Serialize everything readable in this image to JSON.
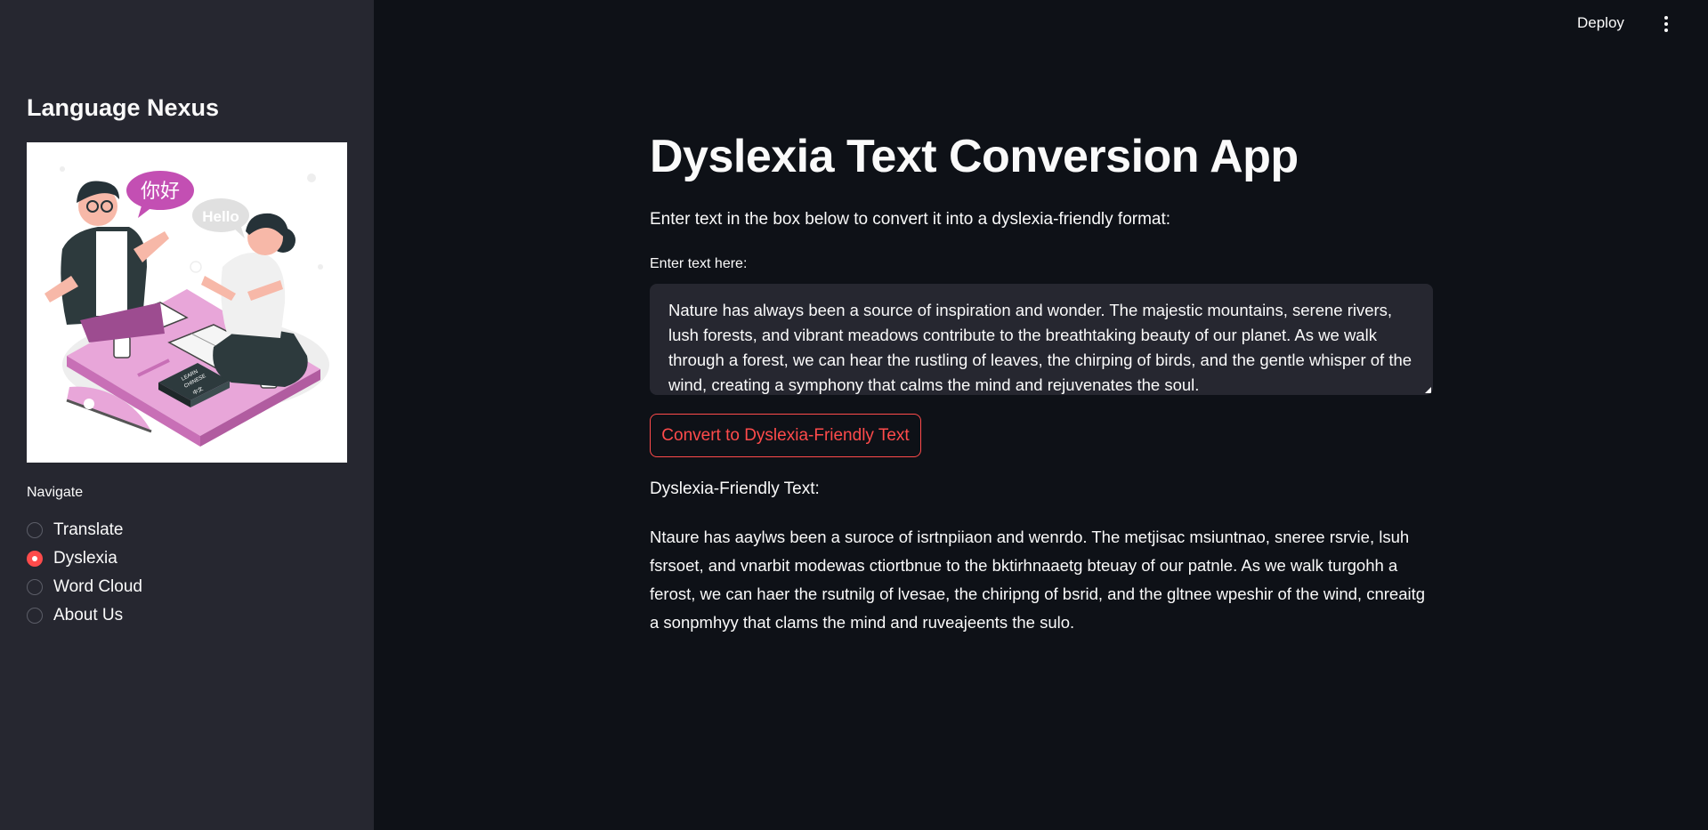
{
  "header": {
    "deploy_label": "Deploy",
    "menu_icon": "kebab-menu-icon"
  },
  "sidebar": {
    "title": "Language Nexus",
    "illustration": {
      "speech_bubble_chinese": "你好",
      "speech_bubble_english": "Hello",
      "book_text_1": "LEARN",
      "book_text_2": "CHINESE",
      "book_text_3": "中文"
    },
    "nav_label": "Navigate",
    "nav_items": [
      {
        "label": "Translate",
        "selected": false
      },
      {
        "label": "Dyslexia",
        "selected": true
      },
      {
        "label": "Word Cloud",
        "selected": false
      },
      {
        "label": "About Us",
        "selected": false
      }
    ]
  },
  "main": {
    "title": "Dyslexia Text Conversion App",
    "instructions": "Enter text in the box below to convert it into a dyslexia-friendly format:",
    "input_label": "Enter text here:",
    "input_value": "Nature has always been a source of inspiration and wonder. The majestic mountains, serene rivers, lush forests, and vibrant meadows contribute to the breathtaking beauty of our planet. As we walk through a forest, we can hear the rustling of leaves, the chirping of birds, and the gentle whisper of the wind, creating a symphony that calms the mind and rejuvenates the soul.",
    "convert_button": "Convert to Dyslexia-Friendly Text",
    "output_heading": "Dyslexia-Friendly Text:",
    "output_text": "Ntaure has aaylws been a suroce of isrtnpiiaon and wenrdo. The metjisac msiuntnao, sneree rsrvie, lsuh fsrsoet, and vnarbit modewas ctiortbnue to the bktirhnaaetg bteuay of our patnle. As we walk turgohh a ferost, we can haer the rsutnilg of lvesae, the chiripng of bsrid, and the gltnee wpeshir of the wind, cnreaitg a sonpmhyy that clams the mind and ruveajeents the sulo."
  },
  "colors": {
    "app_background": "#0e1117",
    "sidebar_background": "#262730",
    "accent": "#ff4b4b",
    "text": "#fafafa",
    "input_background": "#262730"
  }
}
